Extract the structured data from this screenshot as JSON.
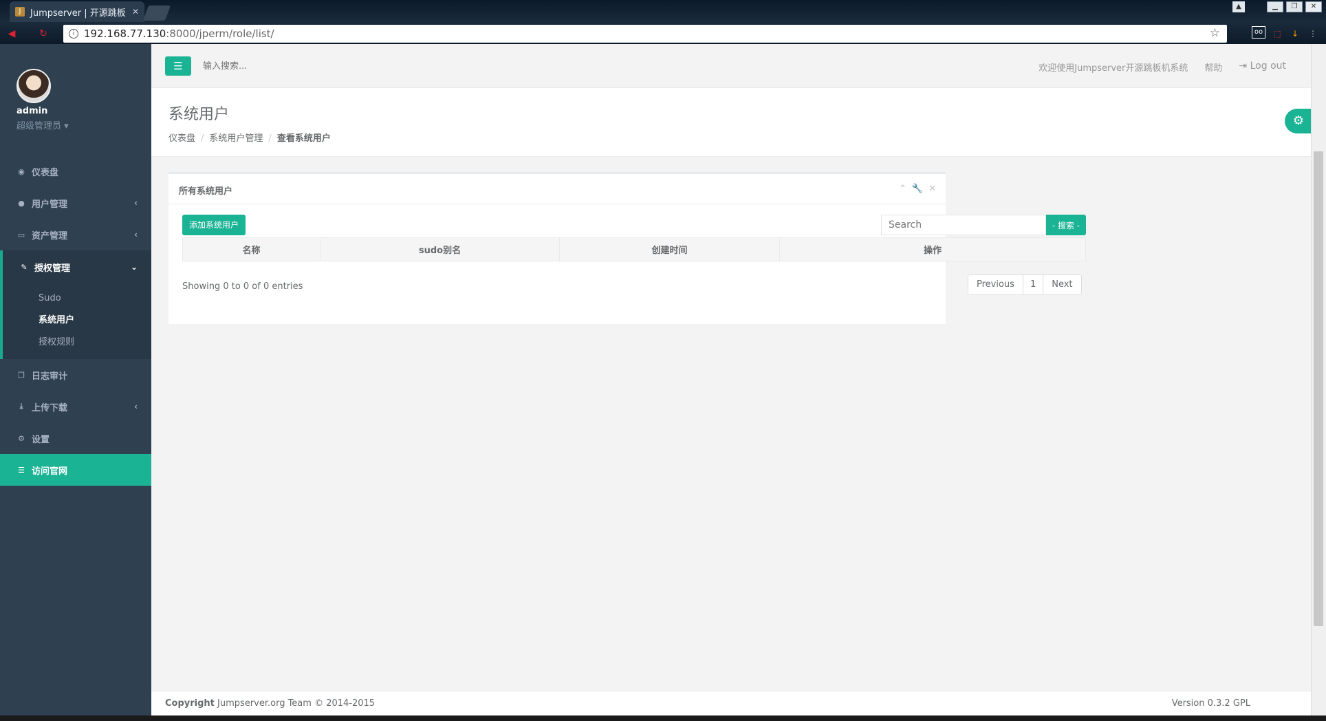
{
  "browser": {
    "tab_title": "Jumpserver | 开源跳板",
    "url_host": "192.168.77.130",
    "url_path": ":8000/jperm/role/list/"
  },
  "sidebar": {
    "username": "admin",
    "role": "超级管理员 ▾",
    "items": [
      {
        "label": "仪表盘",
        "icon": "dashboard-icon"
      },
      {
        "label": "用户管理",
        "icon": "users-icon"
      },
      {
        "label": "资产管理",
        "icon": "inbox-icon"
      },
      {
        "label": "授权管理",
        "icon": "edit-icon"
      },
      {
        "label": "日志审计",
        "icon": "files-icon"
      },
      {
        "label": "上传下载",
        "icon": "download-icon"
      },
      {
        "label": "设置",
        "icon": "gears-icon"
      },
      {
        "label": "访问官网",
        "icon": "database-icon"
      }
    ],
    "submenu": [
      "Sudo",
      "系统用户",
      "授权规则"
    ]
  },
  "topbar": {
    "search_placeholder": "输入搜索...",
    "welcome": "欢迎使用Jumpserver开源跳板机系统",
    "help": "帮助",
    "logout": "Log out"
  },
  "page": {
    "title": "系统用户",
    "breadcrumb": [
      "仪表盘",
      "系统用户管理",
      "查看系统用户"
    ]
  },
  "panel": {
    "title": "所有系统用户",
    "add_button": "添加系统用户",
    "search_placeholder": "Search",
    "search_button": "- 搜索 -",
    "columns": [
      "名称",
      "sudo别名",
      "创建时间",
      "操作"
    ],
    "info": "Showing 0 to 0 of 0 entries",
    "pager": {
      "prev": "Previous",
      "page": "1",
      "next": "Next"
    }
  },
  "footer": {
    "copyright_label": "Copyright",
    "copyright_text": " Jumpserver.org Team © 2014-2015",
    "version": "Version 0.3.2 GPL"
  },
  "colors": {
    "accent": "#1ab394",
    "sidebar": "#2f4050"
  }
}
